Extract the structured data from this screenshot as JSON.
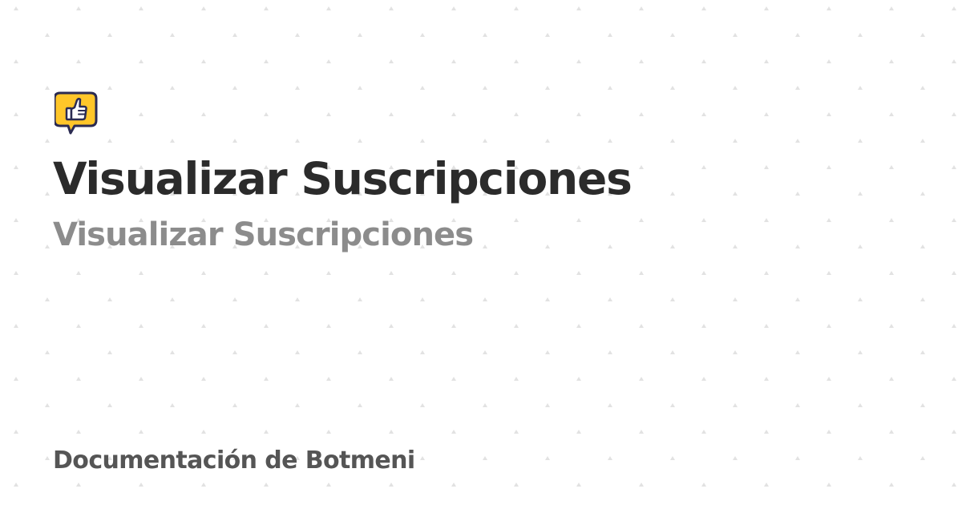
{
  "page": {
    "title": "Visualizar Suscripciones",
    "subtitle": "Visualizar Suscripciones",
    "site_name": "Documentación de Botmeni"
  },
  "logo": {
    "icon": "thumbs-up-speech-bubble-icon",
    "fill_color": "#FFC629",
    "outline_color": "#2B2B52"
  },
  "colors": {
    "background": "#FFFFFF",
    "title": "#2B2B2B",
    "subtitle": "#8C8C8C",
    "site_name": "#555555",
    "dots": "#E2E2E2"
  }
}
